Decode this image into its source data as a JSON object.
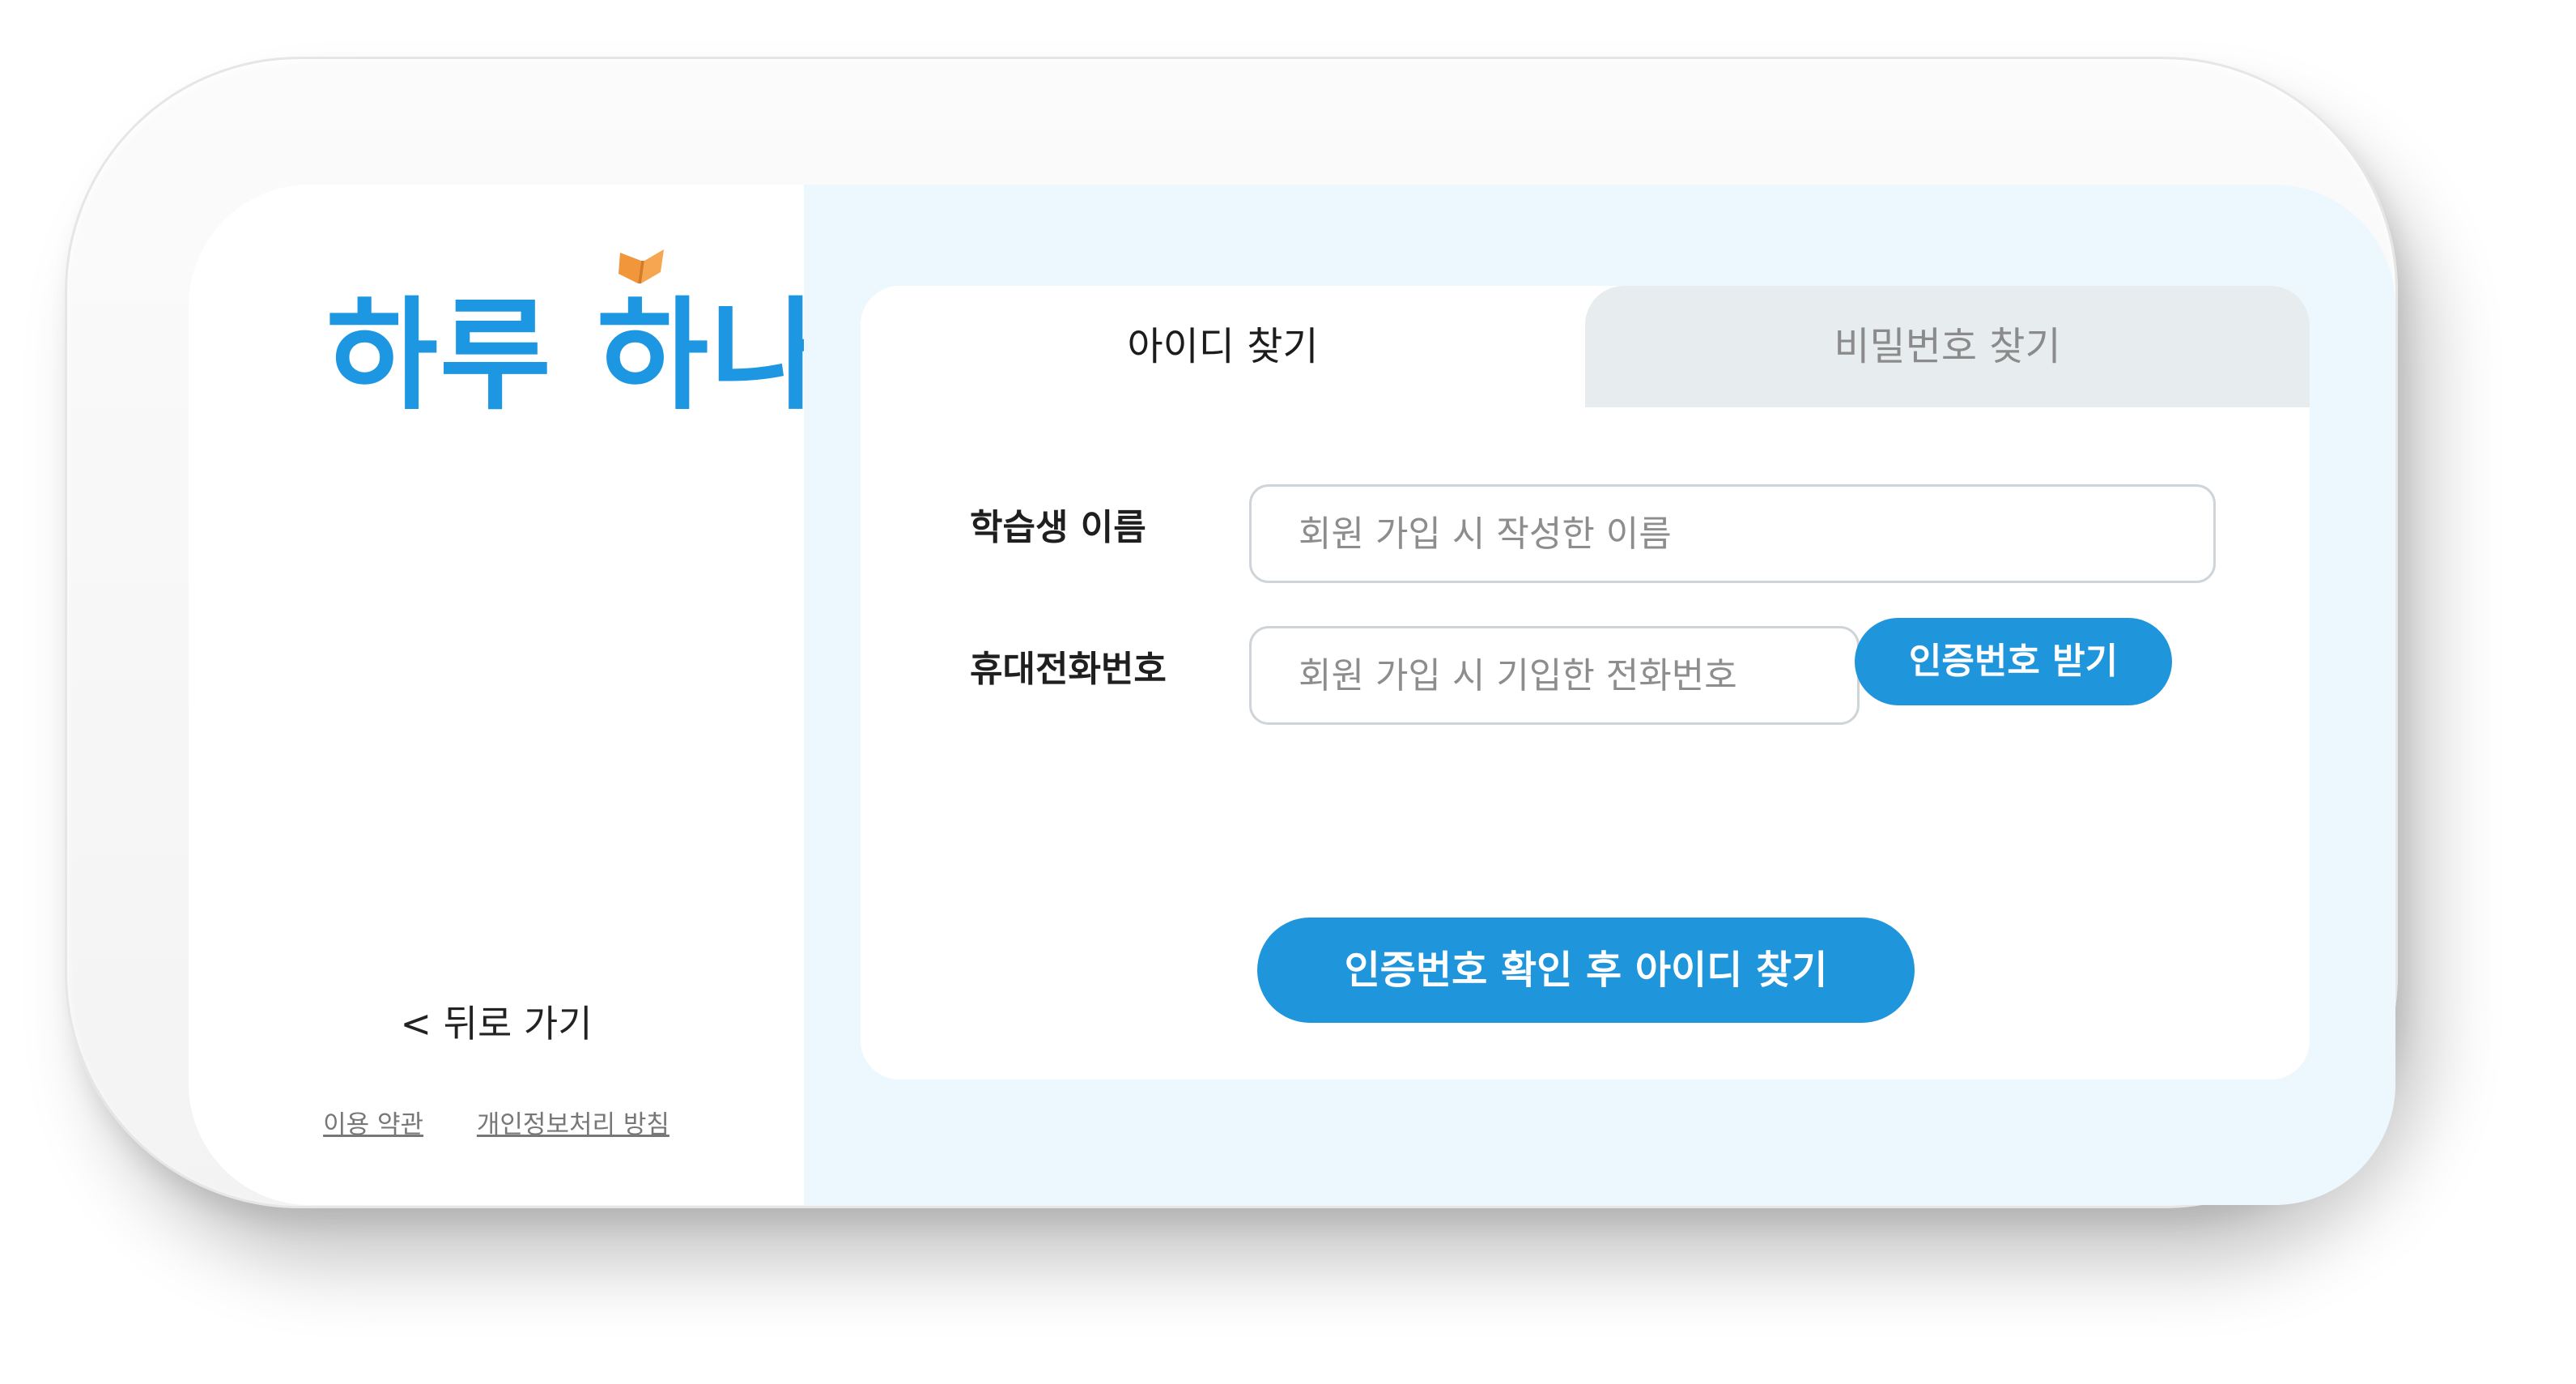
{
  "brand": {
    "logo_text": "하루 하나",
    "logo_icon": "open-book-icon",
    "colors": {
      "primary": "#1f95dc",
      "logo": "#1e97e3",
      "logo_accent": "#f2963b",
      "panel_background": "#edf7fe",
      "inactive_tab": "#e7ecef"
    }
  },
  "sidebar": {
    "back_label": "< 뒤로 가기",
    "links": {
      "terms": "이용 약관",
      "privacy": "개인정보처리 방침"
    }
  },
  "tabs": [
    {
      "label": "아이디 찾기",
      "active": true
    },
    {
      "label": "비밀번호 찾기",
      "active": false
    }
  ],
  "form": {
    "name": {
      "label": "학습생 이름",
      "value": "",
      "placeholder": "회원 가입 시 작성한 이름"
    },
    "phone": {
      "label": "휴대전화번호",
      "value": "",
      "placeholder": "회원 가입 시 기입한 전화번호"
    },
    "request_code_button": "인증번호 받기",
    "submit_button": "인증번호 확인 후 아이디 찾기"
  }
}
